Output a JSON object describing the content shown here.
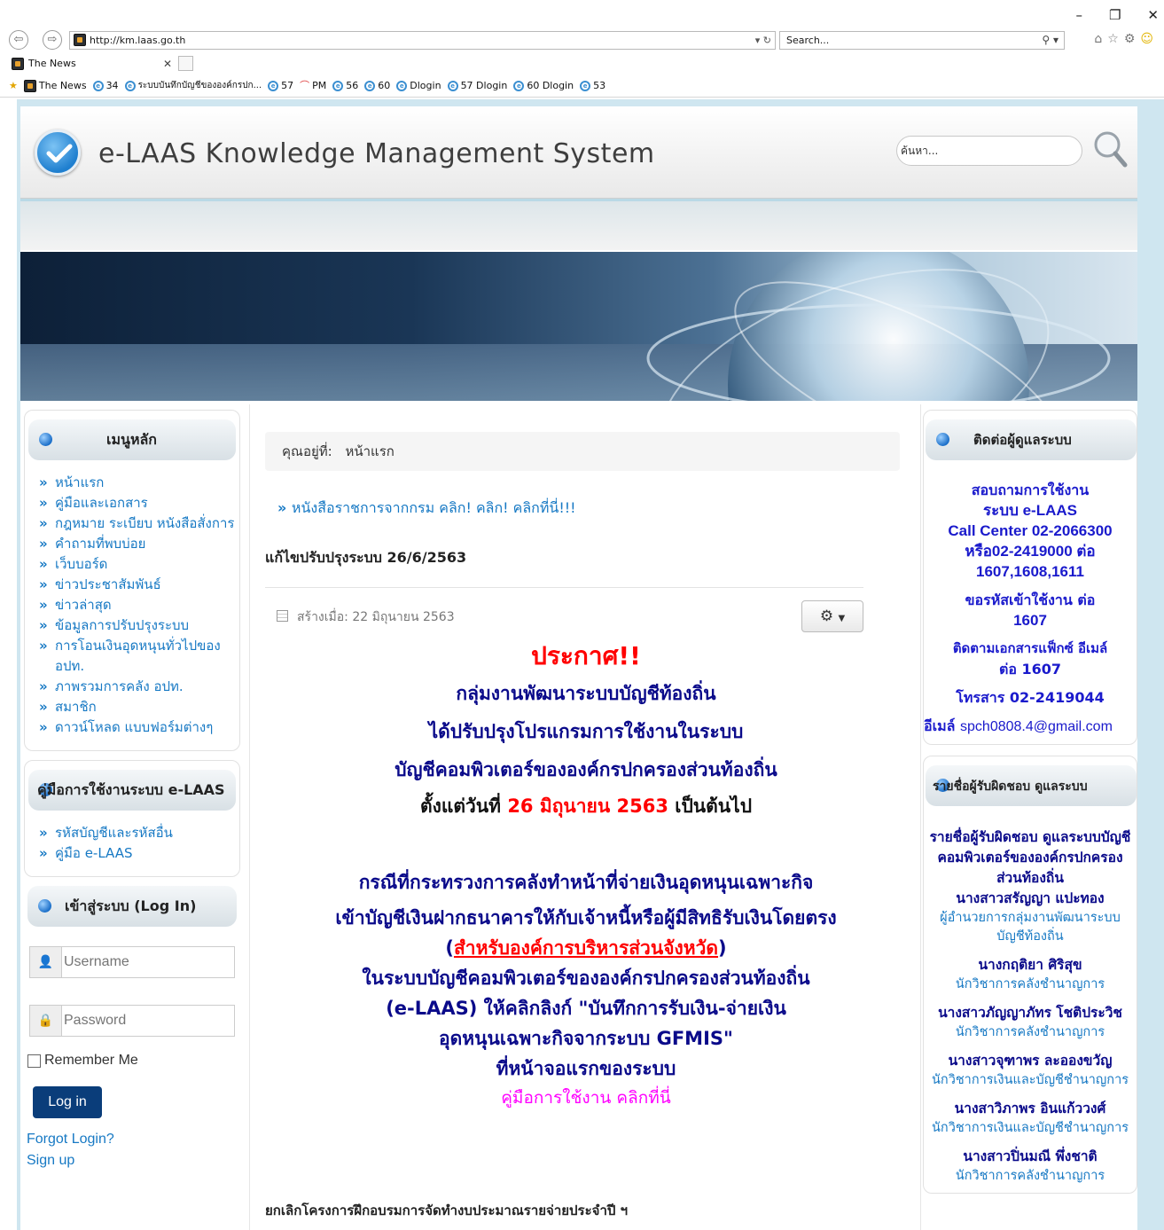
{
  "browser": {
    "url": "http://km.laas.go.th",
    "addr_tools": "▾ ↻",
    "search_placeholder": "Search...",
    "tab_title": "The News",
    "favorites": [
      {
        "label": "The News"
      },
      {
        "label": "34"
      },
      {
        "label": "ระบบบันทึกบัญชีขององค์กรปก..."
      },
      {
        "label": "57"
      },
      {
        "label": "PM"
      },
      {
        "label": "56"
      },
      {
        "label": "60"
      },
      {
        "label": "Dlogin"
      },
      {
        "label": "57 Dlogin"
      },
      {
        "label": "60 Dlogin"
      },
      {
        "label": "53"
      }
    ]
  },
  "header": {
    "site_title": "e-LAAS Knowledge Management System",
    "search_placeholder": "ค้นหา..."
  },
  "left": {
    "main_menu_title": "เมนูหลัก",
    "main_menu": [
      "หน้าแรก",
      "คู่มือและเอกสาร",
      "กฎหมาย ระเบียบ หนังสือสั่งการ",
      "คำถามที่พบบ่อย",
      "เว็บบอร์ด",
      "ข่าวประชาสัมพันธ์",
      "ข่าวล่าสุด",
      "ข้อมูลการปรับปรุงระบบ",
      "การโอนเงินอุดหนุนทั่วไปของ อปท.",
      "ภาพรวมการคลัง อปท.",
      "สมาชิก",
      "ดาวน์โหลด แบบฟอร์มต่างๆ"
    ],
    "guide_title": "คู่มือการใช้งานระบบ e-LAAS",
    "guide_menu": [
      "รหัสบัญชีและรหัสอื่น",
      "คู่มือ e-LAAS"
    ],
    "login_title": "เข้าสู่ระบบ (Log In)",
    "username_placeholder": "Username",
    "password_placeholder": "Password",
    "remember_label": "Remember Me",
    "login_button": "Log in",
    "forgot_link": "Forgot Login?",
    "signup_link": "Sign up"
  },
  "center": {
    "breadcrumb_label": "คุณอยู่ที่:",
    "breadcrumb_current": "หน้าแรก",
    "top_link": "หนังสือราชการจากกรม คลิก! คลิก! คลิกที่นี่!!!",
    "article_title": "แก้ไขปรับปรุงระบบ 26/6/2563",
    "created": "สร้างเมื่อ: 22 มิถุนายน 2563",
    "announce": {
      "headline": "ประกาศ!!",
      "l1": "กลุ่มงานพัฒนาระบบบัญชีท้องถิ่น",
      "l2": "ได้ปรับปรุงโปรแกรมการใช้งานในระบบ",
      "l3": "บัญชีคอมพิวเตอร์ขององค์กรปกครองส่วนท้องถิ่น",
      "l4_pre": "ตั้งแต่วันที่",
      "l4_date": "26 มิถุนายน 2563",
      "l4_post": "เป็นต้นไป",
      "p1": "กรณีที่กระทรวงการคลังทำหน้าที่จ่ายเงินอุดหนุนเฉพาะกิจ",
      "p2": "เข้าบัญชีเงินฝากธนาคารให้กับเจ้าหนี้หรือผู้มีสิทธิรับเงินโดยตรง",
      "p3_link": "สำหรับองค์การบริหารส่วนจังหวัด",
      "p4": "ในระบบบัญชีคอมพิวเตอร์ขององค์กรปกครองส่วนท้องถิ่น",
      "p5": "(e-LAAS) ให้คลิกลิงก์ \"บันทึกการรับเงิน-จ่ายเงิน",
      "p6": "อุดหนุนเฉพาะกิจจากระบบ GFMIS\"",
      "p7": "ที่หน้าจอแรกของระบบ",
      "manual": "คู่มือการใช้งาน คลิกที่นี่"
    },
    "next_article_title": "ยกเลิกโครงการฝึกอบรมการจัดทำงบประมาณรายจ่ายประจำปี ฯ"
  },
  "right": {
    "contact_title": "ติดต่อผู้ดูแลระบบ",
    "contact": {
      "l1": "สอบถามการใช้งาน",
      "l2": "ระบบ e-LAAS",
      "l3": "Call Center 02-2066300",
      "l4": "หรือ02-2419000 ต่อ",
      "l5": "1607,1608,1611",
      "l6": "ขอรหัสเข้าใช้งาน ต่อ",
      "l7": "1607",
      "l8": "ติดตามเอกสารแฟ็กซ์ อีเมล์",
      "l9": "ต่อ 1607",
      "fax": "โทรสาร 02-2419044",
      "email_label": "อีเมล์",
      "email": "spch0808.4@gmail.com"
    },
    "staff_title": "รายชื่อผู้รับผิดชอบ ดูแลระบบ",
    "staff_heading": "รายชื่อผู้รับผิดชอบ ดูแลระบบบัญชีคอมพิวเตอร์ขององค์กรปกครองส่วนท้องถิ่น",
    "staff": [
      {
        "name": "นางสาวสรัญญา แปะทอง",
        "role": "ผู้อำนวยการกลุ่มงานพัฒนาระบบบัญชีท้องถิ่น"
      },
      {
        "name": "นางกฤติยา ศิริสุข",
        "role": "นักวิชาการคลังชำนาญการ"
      },
      {
        "name": "นางสาวภัญญาภัทร โชติประวิช",
        "role": "นักวิชาการคลังชำนาญการ"
      },
      {
        "name": "นางสาวจุฑาพร ละอองขวัญ",
        "role": "นักวิชาการเงินและบัญชีชำนาญการ"
      },
      {
        "name": "นางสาวิภาพร อินแก้ววงศ์",
        "role": "นักวิชาการเงินและบัญชีชำนาญการ"
      },
      {
        "name": "นางสาวปิ่นมณี พึ่งชาติ",
        "role": "นักวิชาการคลังชำนาญการ"
      }
    ]
  },
  "colors": {
    "accent_blue": "#1779c4",
    "announce_red": "#ff0000",
    "announce_navy": "#0a0a8a",
    "login_button": "#0a3d7a"
  }
}
